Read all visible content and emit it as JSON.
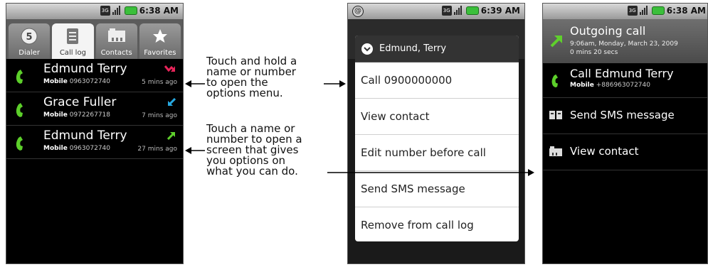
{
  "phone1": {
    "status_time": "6:38 AM",
    "tabs": [
      {
        "label": "Dialer",
        "icon": "dialer-icon",
        "active": false
      },
      {
        "label": "Call log",
        "icon": "call-log-icon",
        "active": true
      },
      {
        "label": "Contacts",
        "icon": "contacts-icon",
        "active": false
      },
      {
        "label": "Favorites",
        "icon": "star-icon",
        "active": false
      }
    ],
    "calls": [
      {
        "name": "Edmund Terry",
        "type_label": "Mobile",
        "number": "0963072740",
        "time": "5 mins ago",
        "call_type": "missed",
        "type_color": "#e8245a"
      },
      {
        "name": "Grace Fuller",
        "type_label": "Mobile",
        "number": "0972267718",
        "time": "7 mins ago",
        "call_type": "incoming",
        "type_color": "#27a9e1"
      },
      {
        "name": "Edmund Terry",
        "type_label": "Mobile",
        "number": "0963072740",
        "time": "27 mins ago",
        "call_type": "outgoing",
        "type_color": "#5fd02c"
      }
    ]
  },
  "annotations": {
    "hold": [
      "Touch and hold a",
      "name or number",
      "to open the",
      "options menu."
    ],
    "touch": [
      "Touch a name or",
      "number to open a",
      "screen that gives",
      "you options on",
      "what you can do."
    ]
  },
  "phone2": {
    "status_time": "6:39 AM",
    "dialog_title": "Edmund, Terry",
    "options": [
      "Call 0900000000",
      "View contact",
      "Edit number before call",
      "Send SMS message",
      "Remove from call log"
    ]
  },
  "phone3": {
    "status_time": "6:38 AM",
    "outgoing_title": "Outgoing call",
    "outgoing_datetime": "9:06am, Monday, March 23, 2009",
    "outgoing_duration": "0 mins 20 secs",
    "call_label": "Call Edmund Terry",
    "call_type_label": "Mobile",
    "call_number": "+886963072740",
    "sms_label": "Send SMS message",
    "view_label": "View contact"
  }
}
